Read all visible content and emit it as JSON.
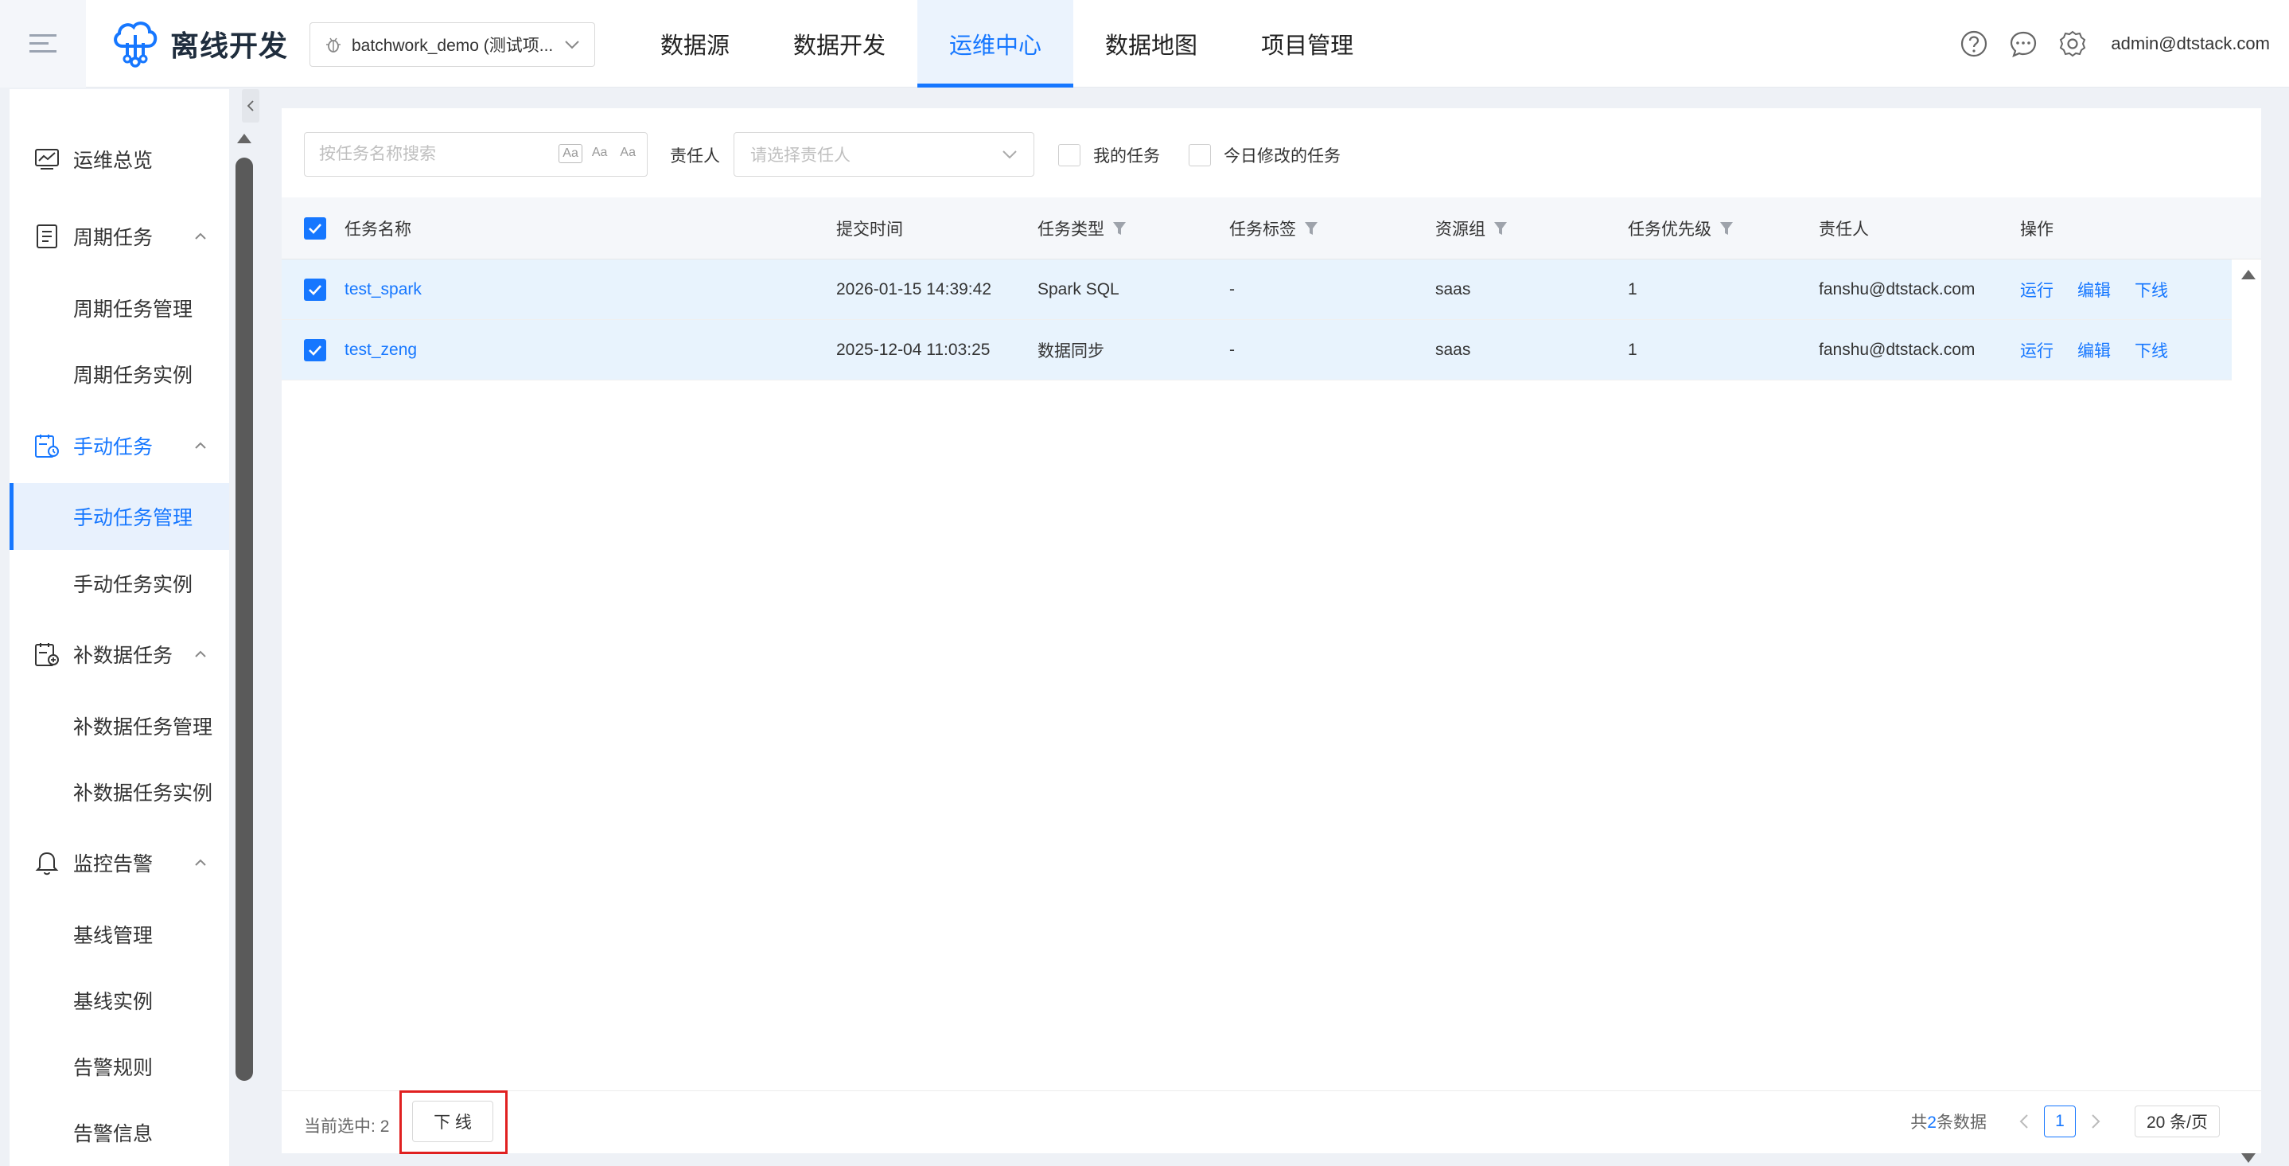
{
  "header": {
    "app_title": "离线开发",
    "project": "batchwork_demo (测试项...",
    "nav": [
      "数据源",
      "数据开发",
      "运维中心",
      "数据地图",
      "项目管理"
    ],
    "active_nav": "运维中心",
    "user": "admin@dtstack.com",
    "icons": [
      "help-icon",
      "message-icon",
      "settings-icon"
    ]
  },
  "sidebar": {
    "overview": "运维总览",
    "periodic": {
      "label": "周期任务",
      "items": [
        "周期任务管理",
        "周期任务实例"
      ]
    },
    "manual": {
      "label": "手动任务",
      "items": [
        "手动任务管理",
        "手动任务实例"
      ],
      "active_item": "手动任务管理"
    },
    "backfill": {
      "label": "补数据任务",
      "items": [
        "补数据任务管理",
        "补数据任务实例"
      ]
    },
    "monitor": {
      "label": "监控告警",
      "items": [
        "基线管理",
        "基线实例",
        "告警规则",
        "告警信息"
      ]
    }
  },
  "filters": {
    "search_placeholder": "按任务名称搜索",
    "search_tools": [
      "Aa",
      "Aa",
      "Aa"
    ],
    "owner_label": "责任人",
    "owner_placeholder": "请选择责任人",
    "my_tasks": "我的任务",
    "today_modified": "今日修改的任务"
  },
  "table": {
    "columns": [
      "任务名称",
      "提交时间",
      "任务类型",
      "任务标签",
      "资源组",
      "任务优先级",
      "责任人",
      "操作"
    ],
    "rows": [
      {
        "name": "test_spark",
        "submit_time": "2026-01-15 14:39:42",
        "type": "Spark SQL",
        "tag": "-",
        "resource_group": "saas",
        "priority": "1",
        "owner": "fanshu@dtstack.com",
        "actions": [
          "运行",
          "编辑",
          "下线"
        ]
      },
      {
        "name": "test_zeng",
        "submit_time": "2025-12-04 11:03:25",
        "type": "数据同步",
        "tag": "-",
        "resource_group": "saas",
        "priority": "1",
        "owner": "fanshu@dtstack.com",
        "actions": [
          "运行",
          "编辑",
          "下线"
        ]
      }
    ]
  },
  "footer": {
    "selected_label": "当前选中:",
    "selected_count": "2",
    "offline_button": "下 线",
    "total_prefix": "共",
    "total_count": "2",
    "total_suffix": "条数据",
    "current_page": "1",
    "page_size": "20 条/页"
  },
  "colors": {
    "accent": "#1677ff",
    "row_selected": "#e8f3fd",
    "highlight": "#e02020"
  }
}
